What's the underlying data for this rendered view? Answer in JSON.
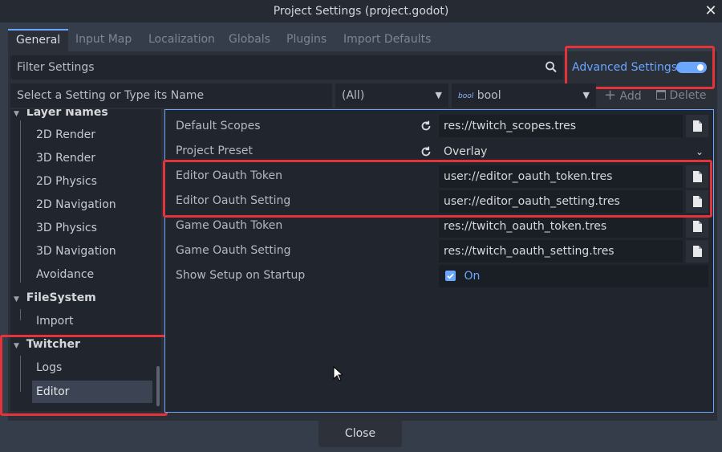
{
  "window": {
    "title": "Project Settings (project.godot)"
  },
  "tabs": [
    {
      "label": "General"
    },
    {
      "label": "Input Map"
    },
    {
      "label": "Localization"
    },
    {
      "label": "Globals"
    },
    {
      "label": "Plugins"
    },
    {
      "label": "Import Defaults"
    }
  ],
  "filter": {
    "placeholder": "Filter Settings"
  },
  "advanced": {
    "label": "Advanced Settings",
    "enabled": true
  },
  "add_row": {
    "setting_placeholder": "Select a Setting or Type its Name",
    "scope_value": "(All)",
    "type_badge": "bool",
    "type_value": "bool",
    "add_label": "Add",
    "delete_label": "Delete"
  },
  "tree": {
    "layer_names": {
      "label": "Layer Names",
      "items": [
        "2D Render",
        "3D Render",
        "2D Physics",
        "2D Navigation",
        "3D Physics",
        "3D Navigation",
        "Avoidance"
      ]
    },
    "filesystem": {
      "label": "FileSystem",
      "items": [
        "Import"
      ]
    },
    "twitcher": {
      "label": "Twitcher",
      "items": [
        "Logs",
        "Editor"
      ],
      "selected": "Editor"
    }
  },
  "properties": [
    {
      "label": "Default Scopes",
      "value": "res://twitch_scopes.tres"
    },
    {
      "label": "Project Preset",
      "value": "Overlay"
    },
    {
      "label": "Editor Oauth Token",
      "value": "user://editor_oauth_token.tres"
    },
    {
      "label": "Editor Oauth Setting",
      "value": "user://editor_oauth_setting.tres"
    },
    {
      "label": "Game Oauth Token",
      "value": "res://twitch_oauth_token.tres"
    },
    {
      "label": "Game Oauth Setting",
      "value": "res://twitch_oauth_setting.tres"
    },
    {
      "label": "Show Setup on Startup",
      "value": "On"
    }
  ],
  "footer": {
    "close_label": "Close"
  },
  "colors": {
    "accent": "#6ba6ff",
    "highlight": "#e5333a",
    "background": "#363d4a",
    "panel": "#21262e"
  }
}
